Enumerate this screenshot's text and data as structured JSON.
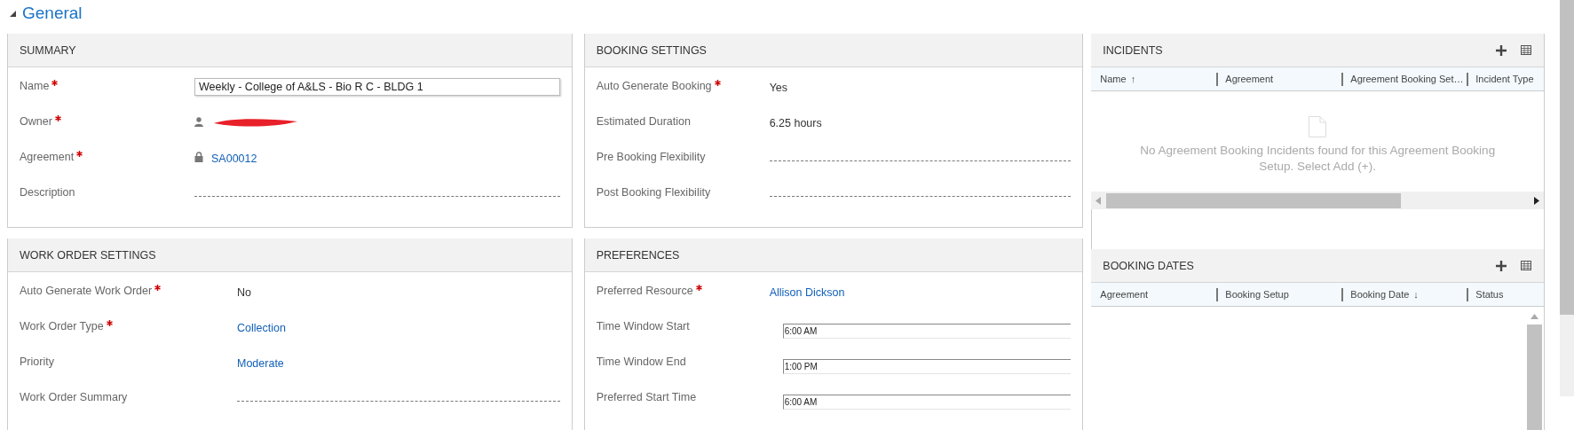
{
  "section": {
    "title": "General",
    "expanded": true
  },
  "left_column": {
    "panels": [
      {
        "title": "SUMMARY",
        "fields": [
          {
            "label": "Name",
            "required": true,
            "kind": "input",
            "value": "Weekly - College of A&LS - Bio R C - BLDG 1"
          },
          {
            "label": "Owner",
            "required": true,
            "kind": "owner"
          },
          {
            "label": "Agreement",
            "required": true,
            "kind": "locked-lookup",
            "value": "SA00012"
          },
          {
            "label": "Description",
            "required": false,
            "kind": "empty"
          }
        ]
      },
      {
        "title": "WORK ORDER SETTINGS",
        "fields": [
          {
            "label": "Auto Generate Work Order",
            "required": true,
            "kind": "text",
            "value": "No"
          },
          {
            "label": "Work Order Type",
            "required": true,
            "kind": "lookup",
            "value": "Collection"
          },
          {
            "label": "Priority",
            "required": false,
            "kind": "lookup",
            "value": "Moderate"
          },
          {
            "label": "Work Order Summary",
            "required": false,
            "kind": "empty"
          }
        ]
      }
    ]
  },
  "middle_column": {
    "panels": [
      {
        "title": "BOOKING SETTINGS",
        "fields": [
          {
            "label": "Auto Generate Booking",
            "required": true,
            "kind": "text",
            "value": "Yes"
          },
          {
            "label": "Estimated Duration",
            "required": false,
            "kind": "text",
            "value": "6.25 hours"
          },
          {
            "label": "Pre Booking Flexibility",
            "required": false,
            "kind": "empty"
          },
          {
            "label": "Post Booking Flexibility",
            "required": false,
            "kind": "empty"
          }
        ]
      },
      {
        "title": "PREFERENCES",
        "fields": [
          {
            "label": "Preferred Resource",
            "required": true,
            "kind": "lookup",
            "value": "Allison Dickson"
          },
          {
            "label": "Time Window Start",
            "required": false,
            "kind": "time",
            "value": "6:00 AM"
          },
          {
            "label": "Time Window End",
            "required": false,
            "kind": "time",
            "value": "1:00 PM"
          },
          {
            "label": "Preferred Start Time",
            "required": false,
            "kind": "time",
            "value": "6:00 AM"
          }
        ]
      }
    ]
  },
  "right_column": {
    "subgrids": [
      {
        "title": "INCIDENTS",
        "columns": [
          {
            "label": "Name",
            "sort_arrow": "↑"
          },
          {
            "label": "Agreement"
          },
          {
            "label": "Agreement Booking Set…"
          },
          {
            "label": "Incident Type"
          }
        ],
        "empty_message": "No Agreement Booking Incidents found for this Agreement Booking Setup. Select Add (+)."
      },
      {
        "title": "BOOKING DATES",
        "columns": [
          {
            "label": "Agreement"
          },
          {
            "label": "Booking Setup"
          },
          {
            "label": "Booking Date",
            "sort_arrow": "↓"
          },
          {
            "label": "Status"
          }
        ]
      }
    ]
  }
}
